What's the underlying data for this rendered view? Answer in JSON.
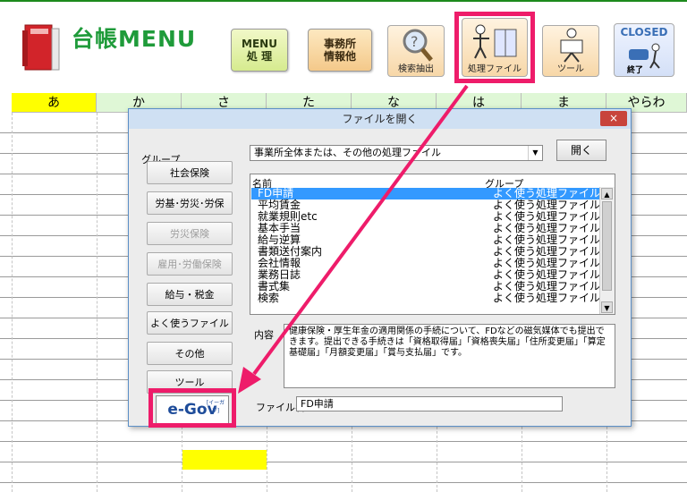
{
  "app": {
    "logo_text": "台帳MENU"
  },
  "toolbar": {
    "menu_label": "MENU\n処 理",
    "office_label": "事務所\n情報他",
    "search_label": "検索抽出",
    "files_label": "処理ファイル",
    "tool_label": "ツール",
    "closed_label": "CLOSED",
    "exit_label": "終了"
  },
  "columns": [
    "あ",
    "か",
    "さ",
    "た",
    "な",
    "は",
    "ま",
    "やらわ"
  ],
  "dialog": {
    "title": "ファイルを開く",
    "close": "×",
    "group_label": "グループ",
    "groups": [
      {
        "label": "社会保険"
      },
      {
        "label": "労基･労災･労保"
      },
      {
        "label": "労災保険"
      },
      {
        "label": "雇用･労働保険"
      },
      {
        "label": "給与・税金"
      },
      {
        "label": "よく使うファイル"
      },
      {
        "label": "その他"
      },
      {
        "label": "ツール"
      }
    ],
    "folder_value": "事業所全体または、その他の処理ファイル",
    "open_label": "開く",
    "list_header_name": "名前",
    "list_header_group": "グループ",
    "files": [
      {
        "name": "FD申請",
        "group": "よく使う処理ファイル"
      },
      {
        "name": "平均賃金",
        "group": "よく使う処理ファイル"
      },
      {
        "name": "就業規則etc",
        "group": "よく使う処理ファイル"
      },
      {
        "name": "基本手当",
        "group": "よく使う処理ファイル"
      },
      {
        "name": "給与逆算",
        "group": "よく使う処理ファイル"
      },
      {
        "name": "書類送付案内",
        "group": "よく使う処理ファイル"
      },
      {
        "name": "会社情報",
        "group": "よく使う処理ファイル"
      },
      {
        "name": "業務日誌",
        "group": "よく使う処理ファイル"
      },
      {
        "name": "書式集",
        "group": "よく使う処理ファイル"
      },
      {
        "name": "検索",
        "group": "よく使う処理ファイル"
      }
    ],
    "desc_label": "内容",
    "description": "健康保険・厚生年金の適用関係の手続について、FDなどの磁気媒体でも提出できます。提出できる手続きは「資格取得届」「資格喪失届」「住所変更届」「算定基礎届」「月額変更届」「賞与支払届」です。",
    "filename_label": "ファイル名",
    "filename_value": "FD申請",
    "egov_label": "e-Gov",
    "egov_small": "[イーガブ]"
  },
  "colors": {
    "highlight": "#ee1c6a",
    "logo_green": "#1f9b3a",
    "selection": "#3399ff"
  }
}
